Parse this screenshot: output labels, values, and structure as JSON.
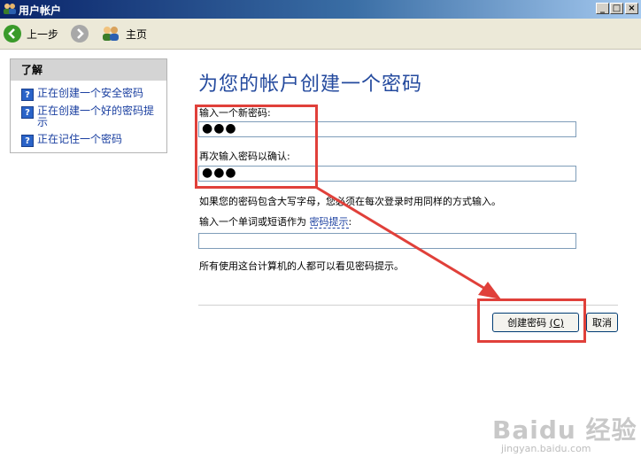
{
  "window": {
    "title": "用户帐户",
    "controls": [
      "minimize",
      "maximize",
      "close"
    ]
  },
  "toolbar": {
    "back_label": "上一步",
    "home_label": "主页"
  },
  "sidebar": {
    "header": "了解",
    "items": [
      {
        "label_line1": "正在创建一个安全密码",
        "label_line2": ""
      },
      {
        "label_line1": "正在创建一个好的密码提",
        "label_line2": "示"
      },
      {
        "label_line1": "正在记住一个密码",
        "label_line2": ""
      }
    ]
  },
  "main": {
    "title": "为您的帐户创建一个密码",
    "new_password_label": "输入一个新密码:",
    "new_password_value": "●●●",
    "confirm_label": "再次输入密码以确认:",
    "confirm_value": "●●●",
    "case_note": "如果您的密码包含大写字母，您必须在每次登录时用同样的方式输入。",
    "hint_label_prefix": "输入一个单词或短语作为",
    "hint_link": "密码提示",
    "hint_label_suffix": ":",
    "hint_value": "",
    "hint_note": "所有使用这台计算机的人都可以看见密码提示。"
  },
  "buttons": {
    "create_label": "创建密码",
    "create_shortcut": "(C)",
    "cancel_label": "取消"
  },
  "watermark": {
    "brand": "Baidu 经验",
    "url": "jingyan.baidu.com"
  },
  "colors": {
    "accent_title": "#244a9e",
    "link": "#1a3fa0",
    "annotation_red": "#e0403a"
  },
  "icons": {
    "back": "back-arrow-icon",
    "forward": "forward-arrow-icon",
    "home": "users-home-icon",
    "help": "help-question-icon"
  }
}
